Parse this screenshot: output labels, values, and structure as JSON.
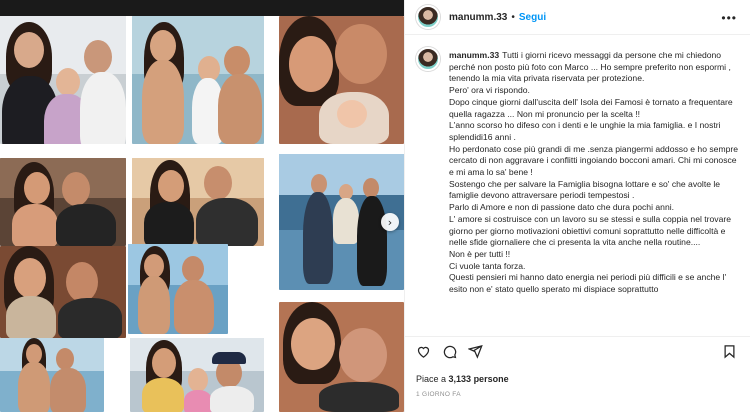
{
  "post": {
    "username": "manumm.33",
    "follow_label": "Segui",
    "separator": "•",
    "more_label": "•••"
  },
  "caption": {
    "username": "manumm.33",
    "lines": [
      "Tutti i giorni ricevo messaggi da persone che mi chiedono perché non posto più foto con Marco ... Ho sempre preferito non espormi , tenendo la mia vita privata riservata per protezione.",
      "Pero' ora vi rispondo.",
      "Dopo cinque giorni dall'uscita dell' Isola dei Famosi è tornato a frequentare quella ragazza ... Non mi pronuncio per la scelta !!",
      "L'anno scorso ho difeso con i denti e le unghie la mia famiglia. e I nostri splendidi16 anni .",
      "Ho perdonato cose più grandi di me .senza piangermi addosso e ho sempre cercato di non aggravare i conflitti ingoiando bocconi amari. Chi mi conosce e mi ama lo sa' bene !",
      "Sostengo che per salvare la Famiglia bisogna lottare e so' che avolte le famiglie devono attraversare periodi tempestosi .",
      "Parlo di Amore e non di passione dato che dura pochi anni.",
      "L' amore si costruisce con un lavoro su se stessi e sulla coppia nel trovare giorno per giorno motivazioni obiettivi comuni soprattutto nelle difficoltà e nelle sfide giornaliere che ci presenta la vita anche nella routine....",
      "Non è per tutti !!",
      "Ci vuole tanta forza.",
      "Questi pensieri mi hanno dato energia nei periodi più difficili e se anche l' esito non e' stato quello sperato mi dispiace soprattutto"
    ]
  },
  "engagement": {
    "likes_prefix": "Piace a ",
    "likes_count": "3,133",
    "likes_suffix": " persone",
    "time_ago": "1 GIORNO FA"
  },
  "icons": {
    "like": "heart-icon",
    "comment": "comment-icon",
    "share": "share-icon",
    "save": "bookmark-icon",
    "next": "chevron-right-icon",
    "more": "more-options-icon"
  },
  "colors": {
    "accent": "#0095f6",
    "text": "#262626",
    "muted": "#8e8e8e",
    "divider": "#efefef"
  }
}
